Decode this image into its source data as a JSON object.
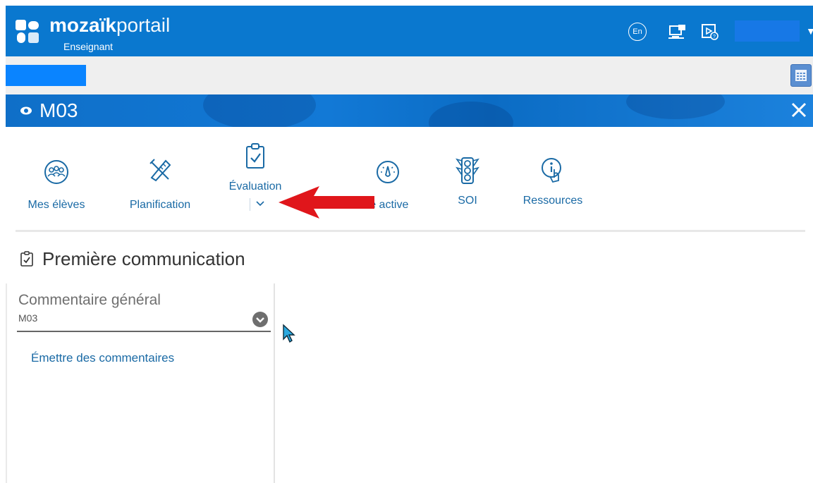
{
  "header": {
    "brand_bold": "mozaïk",
    "brand_light": "portail",
    "role": "Enseignant",
    "lang": "En"
  },
  "band": {
    "title": "M03"
  },
  "nav": {
    "items": [
      {
        "label": "Mes élèves",
        "icon": "students-icon"
      },
      {
        "label": "Planification",
        "icon": "tools-icon"
      },
      {
        "label": "Évaluation",
        "icon": "clipboard-check-icon"
      },
      {
        "label": "le active",
        "icon": "gauge-icon"
      },
      {
        "label": "SOI",
        "icon": "traffic-light-icon"
      },
      {
        "label": "Ressources",
        "icon": "touch-info-icon"
      }
    ]
  },
  "section": {
    "title": "Première communication"
  },
  "field": {
    "label": "Commentaire général",
    "value": "M03"
  },
  "link": {
    "label": "Émettre des commentaires"
  },
  "colors": {
    "primary": "#0a78cf",
    "link": "#1a6aa5",
    "annotation_arrow": "#e0161b"
  }
}
